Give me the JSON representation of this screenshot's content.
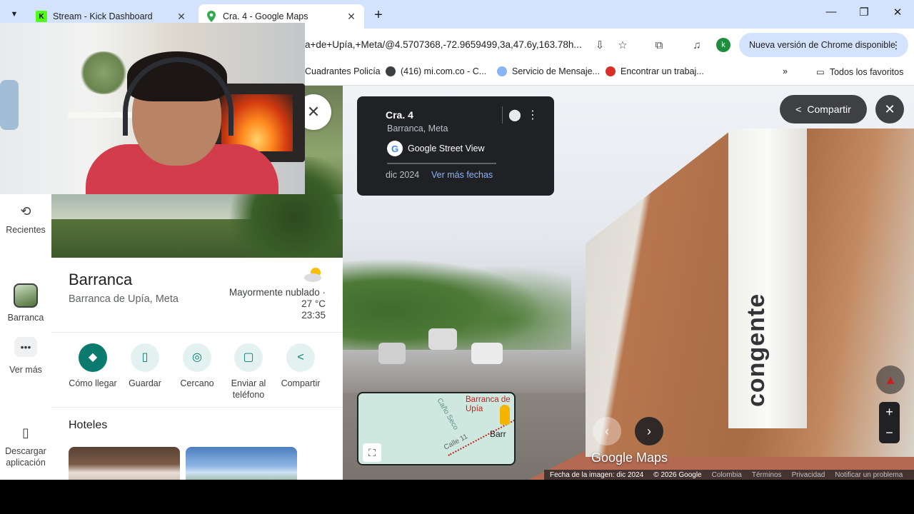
{
  "browser": {
    "tabs": [
      {
        "label": "Stream - Kick Dashboard",
        "favicon": "kick-icon",
        "active": false
      },
      {
        "label": "Cra. 4 - Google Maps",
        "favicon": "google-maps-icon",
        "active": true
      }
    ],
    "url": "a+de+Upía,+Meta/@4.5707368,-72.9659499,3a,47.6y,163.78h...",
    "profile_initial": "k",
    "update_label": "Nueva versión de Chrome disponible",
    "bookmarks": [
      {
        "label": "Cuadrantes Policía"
      },
      {
        "label": "(416) mi.com.co - C..."
      },
      {
        "label": "Servicio de Mensaje..."
      },
      {
        "label": "Encontrar un trabaj..."
      }
    ],
    "all_bookmarks_label": "Todos los favoritos"
  },
  "rail": {
    "recent_label": "Recientes",
    "place_label": "Barranca",
    "more_label": "Ver más",
    "download_label": "Descargar aplicación"
  },
  "place": {
    "name": "Barranca",
    "subtitle": "Barranca de Upía, Meta",
    "weather": "Mayormente nublado · 27 °C",
    "time": "23:35",
    "actions": [
      {
        "label": "Cómo llegar",
        "icon": "directions-icon"
      },
      {
        "label": "Guardar",
        "icon": "bookmark-icon"
      },
      {
        "label": "Cercano",
        "icon": "nearby-icon"
      },
      {
        "label": "Enviar al teléfono",
        "icon": "send-to-phone-icon"
      },
      {
        "label": "Compartir",
        "icon": "share-icon"
      }
    ],
    "hotels_title": "Hoteles"
  },
  "streetview": {
    "card": {
      "title": "Cra. 4",
      "subtitle": "Barranca, Meta",
      "provider": "Google Street View",
      "date": "dic 2024",
      "more_dates": "Ver más fechas"
    },
    "share_label": "Compartir",
    "brand_sign": "congente",
    "logo": "Google Maps",
    "minimap": {
      "city_label": "Barranca de Upía",
      "city_short": "Barr",
      "road_a": "Caño Seco",
      "road_b": "Calle 11"
    },
    "footer": {
      "image_date": "Fecha de la imagen: dic 2024",
      "copyright": "© 2026 Google",
      "country": "Colombia",
      "terms": "Términos",
      "privacy": "Privacidad",
      "report": "Notificar un problema"
    }
  }
}
